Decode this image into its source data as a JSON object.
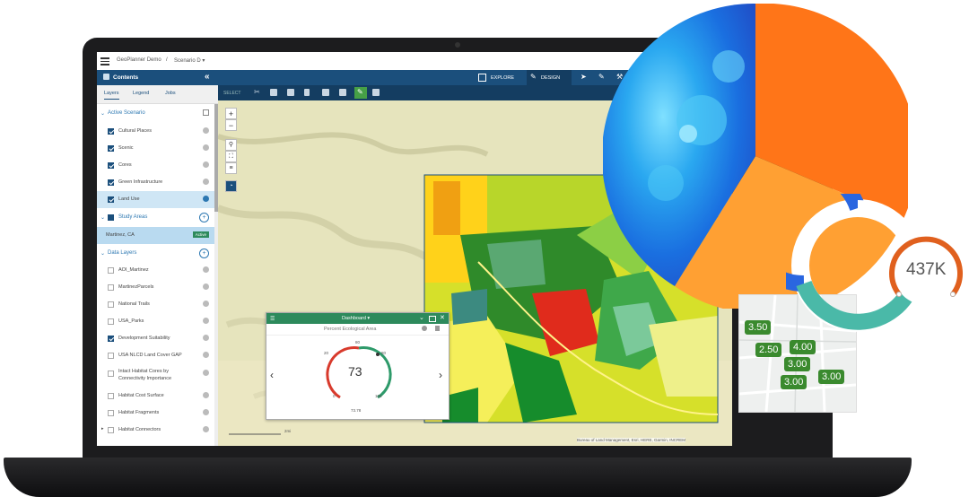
{
  "app": {
    "breadcrumb_project": "GeoPlanner Demo",
    "breadcrumb_sep": "/",
    "breadcrumb_scenario": "Scenario D ▾"
  },
  "sidebar": {
    "title": "Contents",
    "collapse_glyph": "«",
    "tabs": [
      "Layers",
      "Legend",
      "Jobs"
    ],
    "sections": {
      "active_scenario": "Active Scenario",
      "study_areas": "Study Areas",
      "data_layers": "Data Layers"
    },
    "active_layers": [
      {
        "label": "Cultural Places",
        "checked": true
      },
      {
        "label": "Scenic",
        "checked": true
      },
      {
        "label": "Cores",
        "checked": true
      },
      {
        "label": "Green Infrastructure",
        "checked": true
      },
      {
        "label": "Land Use",
        "checked": true
      }
    ],
    "study_area": {
      "label": "Martinez, CA",
      "status": "Active"
    },
    "data_layers": [
      {
        "label": "AOI_Martinez",
        "checked": false
      },
      {
        "label": "MartinezParcels",
        "checked": false
      },
      {
        "label": "National Trails",
        "checked": false
      },
      {
        "label": "USA_Parks",
        "checked": false
      },
      {
        "label": "Development Suitability",
        "checked": true
      },
      {
        "label": "USA NLCD Land Cover GAP",
        "checked": false
      },
      {
        "label": "Intact Habitat Cores by",
        "label2": "Connectivity Importance",
        "checked": false
      },
      {
        "label": "Habitat Cost Surface",
        "checked": false
      },
      {
        "label": "Habitat Fragments",
        "checked": false
      },
      {
        "label": "Habitat Connectors",
        "checked": false
      }
    ]
  },
  "toolbar": {
    "explore": "EXPLORE",
    "design": "DESIGN",
    "select": "SELECT"
  },
  "map": {
    "zoom_in": "+",
    "zoom_out": "−",
    "attribution": "Bureau of Land Management, Esri, HERE, Garmin, INCREM",
    "scale_label": "2mi"
  },
  "dashboard": {
    "title": "Dashboard ▾",
    "subtitle": "Percent Ecological Area",
    "value": "73",
    "tick_top": "80",
    "tick_tl": "20",
    "tick_tr": "80",
    "tick_bl": "0",
    "tick_br": "100",
    "bottom_label": "73.78",
    "prev": "‹",
    "next": "›"
  },
  "overlay": {
    "gauge_value": "437K",
    "badges": [
      "3.50",
      "2.50",
      "4.00",
      "3.00",
      "3.00",
      "3.00"
    ]
  },
  "colors": {
    "nav_blue": "#1b4f7c",
    "accent_green": "#2d8a5c",
    "pie_orange": "#ff7518",
    "pie_light_orange": "#ffa033",
    "pie_blue": "#1a6fe0",
    "donut_blue": "#2a66e0",
    "donut_teal": "#4ab9a8",
    "gauge_orange": "#e0601e"
  }
}
